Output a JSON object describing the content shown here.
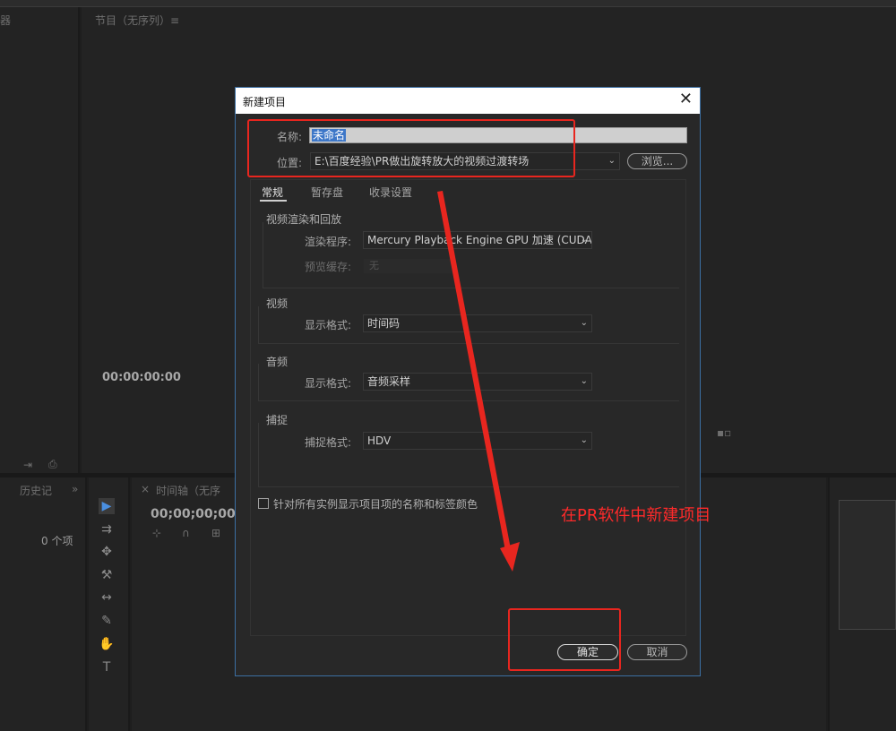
{
  "background": {
    "program_monitor_title": "节目（无序列）≡",
    "left_panel_title": "器",
    "monitor_timecode": "00:00:00:00",
    "history_title": "历史记",
    "history_expand": "»",
    "project_count": "0 个项",
    "timeline_title": "时间轴（无序",
    "timeline_close": "×",
    "timeline_timecode": "00;00;00;00"
  },
  "dialog": {
    "title": "新建项目",
    "name_label": "名称:",
    "name_value": "未命名",
    "location_label": "位置:",
    "location_value": "E:\\百度经验\\PR做出旋转放大的视频过渡转场",
    "browse_label": "浏览...",
    "tabs": [
      {
        "label": "常规"
      },
      {
        "label": "暂存盘"
      },
      {
        "label": "收录设置"
      }
    ],
    "sections": {
      "render": {
        "title": "视频渲染和回放",
        "renderer_label": "渲染程序:",
        "renderer_value": "Mercury Playback Engine GPU 加速 (CUDA)",
        "preview_cache_label": "预览缓存:",
        "preview_cache_value": "无"
      },
      "video": {
        "title": "视频",
        "display_format_label": "显示格式:",
        "display_format_value": "时间码"
      },
      "audio": {
        "title": "音频",
        "display_format_label": "显示格式:",
        "display_format_value": "音频采样"
      },
      "capture": {
        "title": "捕捉",
        "capture_format_label": "捕捉格式:",
        "capture_format_value": "HDV"
      }
    },
    "checkbox_label": "针对所有实例显示项目项的名称和标签颜色",
    "ok_label": "确定",
    "cancel_label": "取消"
  },
  "annotation": {
    "text": "在PR软件中新建项目",
    "color": "#ff2a2a"
  },
  "colors": {
    "accent_border": "#3c6fa3",
    "selection": "#3d77c8",
    "annotation_red": "#e8261f"
  }
}
